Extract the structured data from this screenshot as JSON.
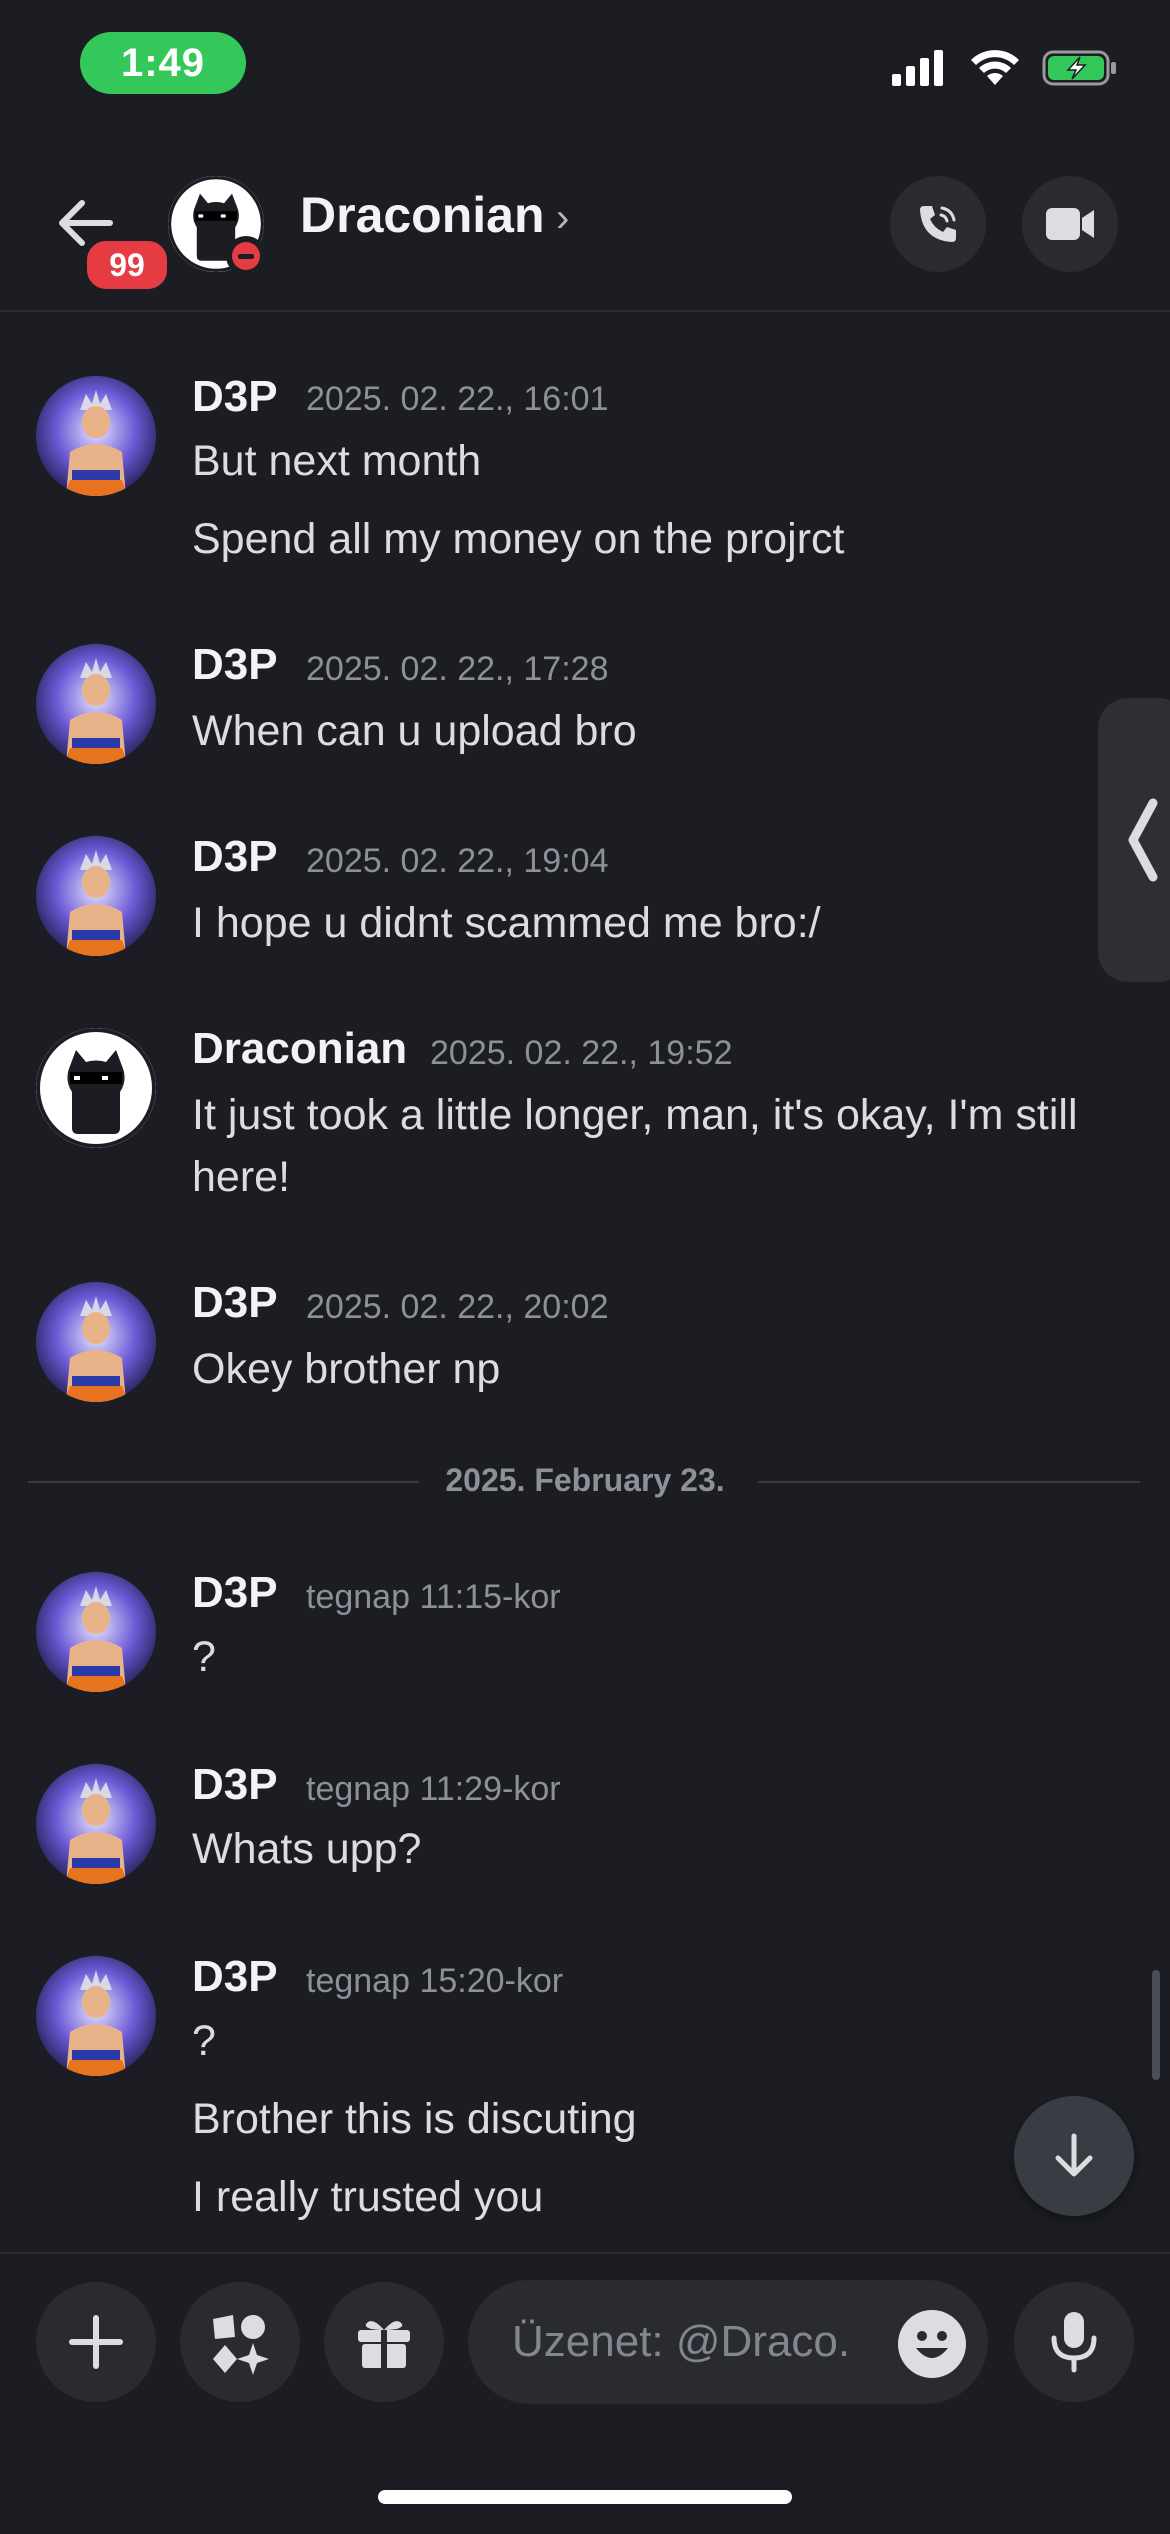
{
  "status_bar": {
    "time": "1:49"
  },
  "header": {
    "back_badge": "99",
    "name": "Draconian",
    "chevron": "›"
  },
  "messages": [
    {
      "author": "D3P",
      "time": "2025. 02. 22., 16:01",
      "lines": [
        "But next month",
        "Spend all my money on the projrct"
      ]
    },
    {
      "author": "D3P",
      "time": "2025. 02. 22., 17:28",
      "lines": [
        "When can u upload bro"
      ]
    },
    {
      "author": "D3P",
      "time": "2025. 02. 22., 19:04",
      "lines": [
        "I hope u didnt scammed me bro:/"
      ]
    },
    {
      "author": "Draconian",
      "time": "2025. 02. 22., 19:52",
      "lines": [
        "It just took a little longer, man, it's okay, I'm still here!"
      ]
    },
    {
      "author": "D3P",
      "time": "2025. 02. 22., 20:02",
      "lines": [
        "Okey brother np"
      ]
    },
    {
      "author": "D3P",
      "time": "tegnap 11:15-kor",
      "lines": [
        "?"
      ]
    },
    {
      "author": "D3P",
      "time": "tegnap 11:29-kor",
      "lines": [
        "Whats upp?"
      ]
    },
    {
      "author": "D3P",
      "time": "tegnap 15:20-kor",
      "lines": [
        "?",
        "Brother this is discuting",
        "I really trusted you"
      ]
    }
  ],
  "date_divider": "2025. February 23.",
  "composer": {
    "placeholder": "Üzenet: @Draco..."
  },
  "colors": {
    "accent_green": "#34c759",
    "badge_red": "#e53b43",
    "background": "#1c1d22"
  }
}
